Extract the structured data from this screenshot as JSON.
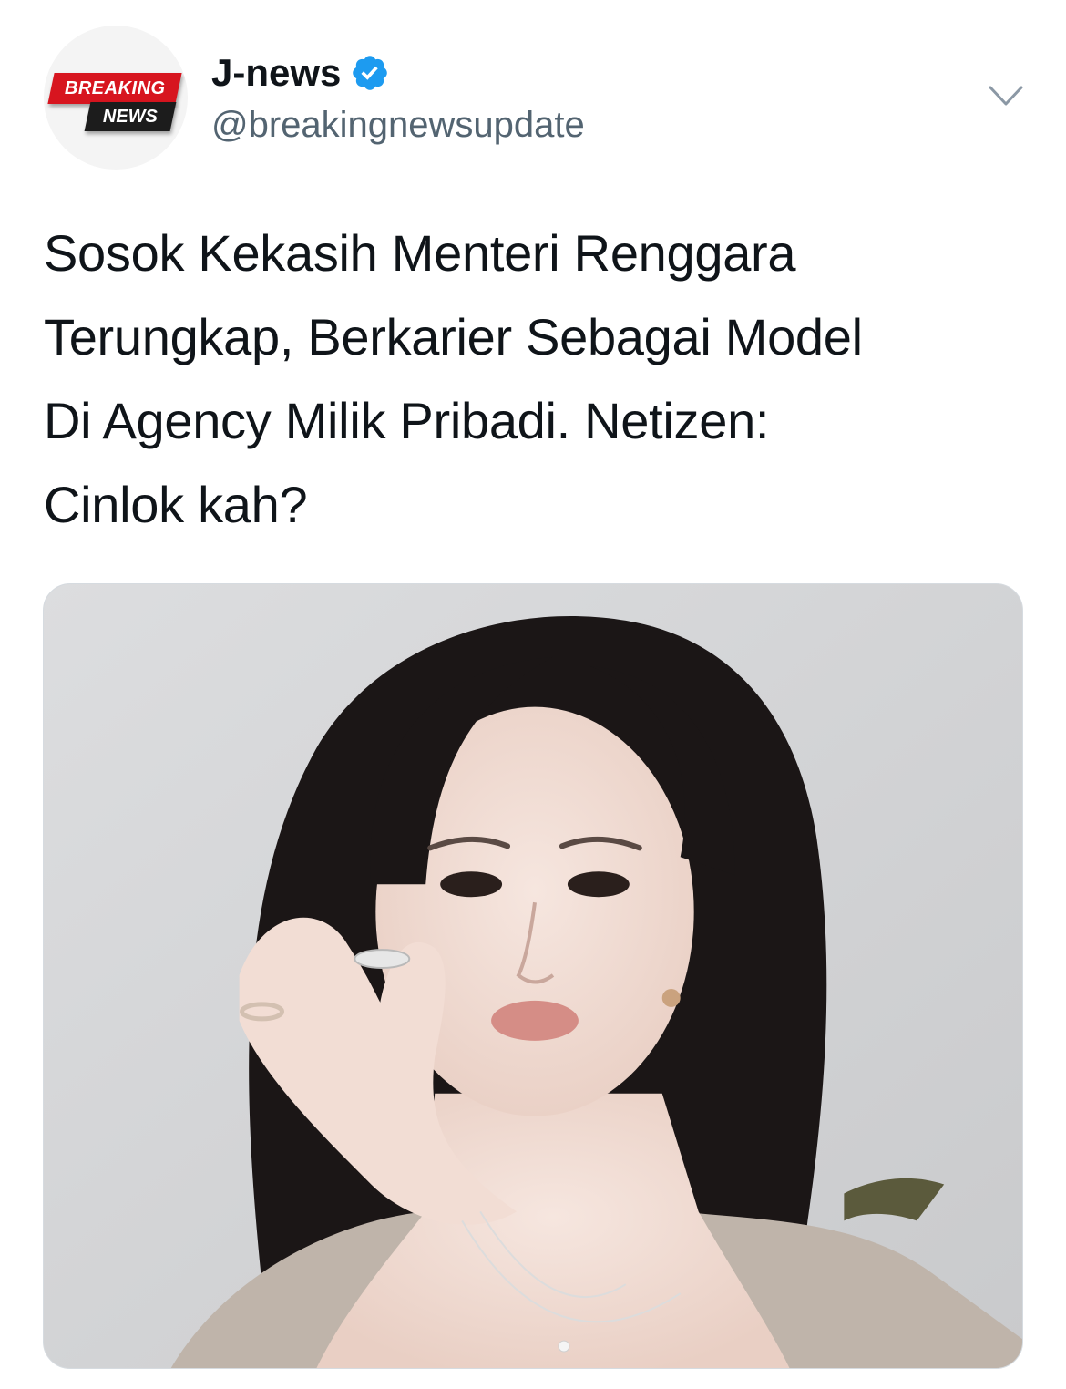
{
  "tweet": {
    "avatar": {
      "badge_top": "BREAKING",
      "badge_bottom": "NEWS"
    },
    "display_name": "J-news",
    "verified": true,
    "handle": "@breakingnewsupdate",
    "text": "Sosok Kekasih Menteri Renggara\nTerungkap, Berkarier Sebagai Model\nDi Agency Milik Pribadi. Netizen:\nCinlok kah?",
    "media": {
      "icon": "photo-portrait"
    }
  },
  "colors": {
    "verified_blue": "#1d9bf0",
    "handle_gray": "#536471",
    "badge_red": "#d7151f",
    "badge_black": "#1c1c1c",
    "photo_background": "#d4d5d7"
  },
  "icons": {
    "verified": "verified-badge-icon",
    "menu": "chevron-down-icon"
  }
}
